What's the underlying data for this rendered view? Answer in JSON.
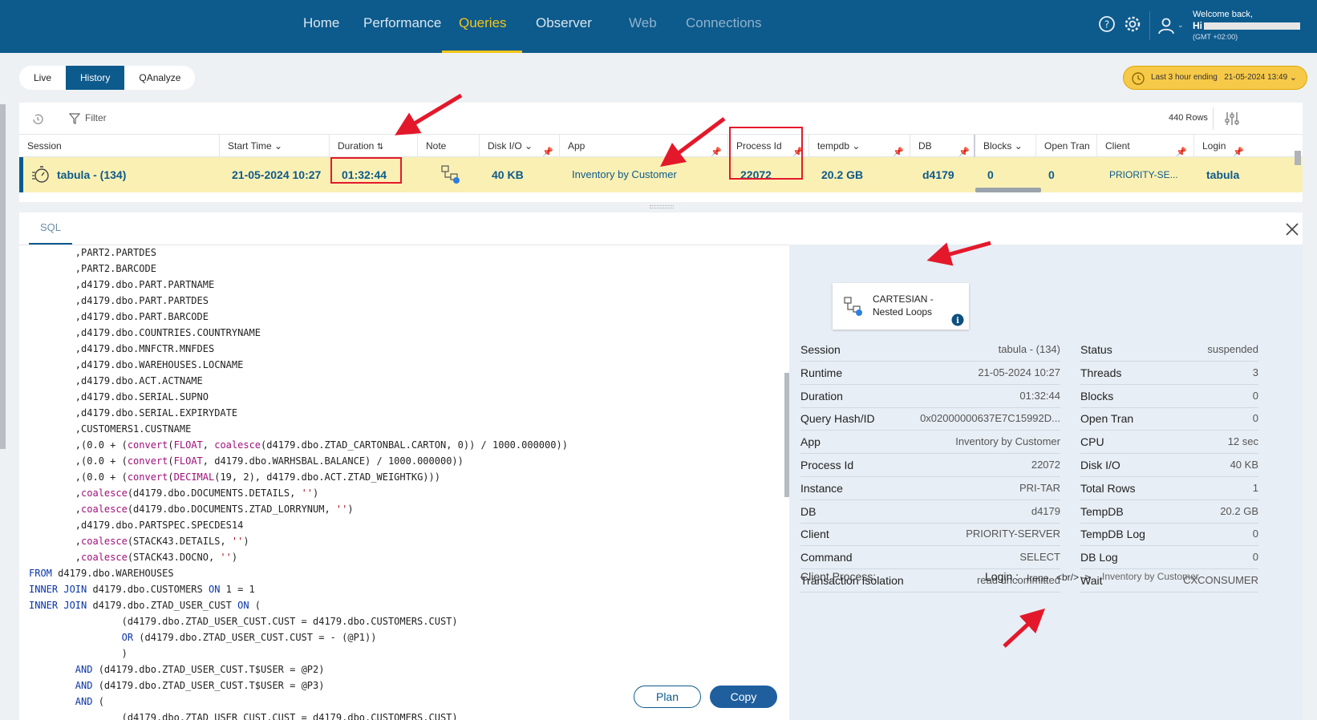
{
  "nav": {
    "items": [
      "Home",
      "Performance",
      "Queries",
      "Observer",
      "Web",
      "Connections"
    ],
    "welcome": "Welcome back,",
    "user_prefix": "Hi",
    "timezone": "(GMT +02:00)"
  },
  "view_tabs": [
    "Live",
    "History",
    "QAnalyze"
  ],
  "time_range": {
    "label": "Last 3 hour ending",
    "value": "21-05-2024 13:49"
  },
  "toolbar": {
    "filter": "Filter",
    "rows": "440 Rows"
  },
  "grid": {
    "headers": [
      "Session",
      "Start Time",
      "Duration",
      "Note",
      "Disk I/O",
      "App",
      "Process Id",
      "tempdb",
      "DB",
      "Blocks",
      "Open Tran",
      "Client",
      "Login"
    ],
    "row": {
      "session": "tabula - (134)",
      "start_time": "21-05-2024 10:27",
      "duration": "01:32:44",
      "disk_io": "40 KB",
      "app": "Inventory by Customer",
      "process_id": "22072",
      "tempdb": "20.2 GB",
      "db": "d4179",
      "blocks": "0",
      "open_tran": "0",
      "client": "PRIORITY-SE...",
      "login": "tabula"
    }
  },
  "sql": {
    "tab": "SQL",
    "plan_button": "Plan",
    "copy_button": "Copy",
    "lines": [
      "        ,PART2.PARTDES",
      "        ,PART2.BARCODE",
      "        ,d4179.dbo.PART.PARTNAME",
      "        ,d4179.dbo.PART.PARTDES",
      "        ,d4179.dbo.PART.BARCODE",
      "        ,d4179.dbo.COUNTRIES.COUNTRYNAME",
      "        ,d4179.dbo.MNFCTR.MNFDES",
      "        ,d4179.dbo.WAREHOUSES.LOCNAME",
      "        ,d4179.dbo.ACT.ACTNAME",
      "        ,d4179.dbo.SERIAL.SUPNO",
      "        ,d4179.dbo.SERIAL.EXPIRYDATE",
      "        ,CUSTOMERS1.CUSTNAME",
      "        ,(0.0 + (convert(FLOAT, coalesce(d4179.dbo.ZTAD_CARTONBAL.CARTON, 0)) / 1000.000000))",
      "        ,(0.0 + (convert(FLOAT, d4179.dbo.WARHSBAL.BALANCE) / 1000.000000))",
      "        ,(0.0 + (convert(DECIMAL(19, 2), d4179.dbo.ACT.ZTAD_WEIGHTKG)))",
      "        ,coalesce(d4179.dbo.DOCUMENTS.DETAILS, '')",
      "        ,coalesce(d4179.dbo.DOCUMENTS.ZTAD_LORRYNUM, '')",
      "        ,d4179.dbo.PARTSPEC.SPECDES14",
      "        ,coalesce(STACK43.DETAILS, '')",
      "        ,coalesce(STACK43.DOCNO, '')",
      "FROM d4179.dbo.WAREHOUSES",
      "INNER JOIN d4179.dbo.CUSTOMERS ON 1 = 1",
      "INNER JOIN d4179.dbo.ZTAD_USER_CUST ON (",
      "                (d4179.dbo.ZTAD_USER_CUST.CUST = d4179.dbo.CUSTOMERS.CUST)",
      "                OR (d4179.dbo.ZTAD_USER_CUST.CUST = - (@P1))",
      "                )",
      "        AND (d4179.dbo.ZTAD_USER_CUST.T$USER = @P2)",
      "        AND (d4179.dbo.ZTAD_USER_CUST.T$USER = @P3)",
      "        AND (",
      "                (d4179.dbo.ZTAD_USER_CUST.CUST = d4179.dbo.CUSTOMERS.CUST)"
    ]
  },
  "plan_card": {
    "line1": "CARTESIAN -",
    "line2": "Nested Loops"
  },
  "details_left": [
    {
      "k": "Session",
      "v": "tabula - (134)"
    },
    {
      "k": "Runtime",
      "v": "21-05-2024 10:27"
    },
    {
      "k": "Duration",
      "v": "01:32:44"
    },
    {
      "k": "Query Hash/ID",
      "v": "0x02000000637E7C15992D..."
    },
    {
      "k": "App",
      "v": "Inventory by Customer"
    },
    {
      "k": "Process Id",
      "v": "22072"
    },
    {
      "k": "Instance",
      "v": "PRI-TAR"
    },
    {
      "k": "DB",
      "v": "d4179"
    },
    {
      "k": "Client",
      "v": "PRIORITY-SERVER"
    },
    {
      "k": "Command",
      "v": "SELECT"
    },
    {
      "k": "Transaction Isolation",
      "v": "read uncommitted"
    }
  ],
  "details_right": [
    {
      "k": "Status",
      "v": "suspended"
    },
    {
      "k": "Threads",
      "v": "3"
    },
    {
      "k": "Blocks",
      "v": "0"
    },
    {
      "k": "Open Tran",
      "v": "0"
    },
    {
      "k": "CPU",
      "v": "12 sec"
    },
    {
      "k": "Disk I/O",
      "v": "40 KB"
    },
    {
      "k": "Total Rows",
      "v": "1"
    },
    {
      "k": "TempDB",
      "v": "20.2 GB"
    },
    {
      "k": "TempDB Log",
      "v": "0"
    },
    {
      "k": "DB Log",
      "v": "0"
    },
    {
      "k": "Wait",
      "v": "CXCONSUMER"
    }
  ],
  "client_process": {
    "label": "Client Process:",
    "login_label": "Login :",
    "login_value": "Irene",
    "separator": "<br/> ->",
    "app": "Inventory by Customer"
  },
  "colors": {
    "nav": "#0d5a8c",
    "accent": "#f5c518",
    "row_highlight": "#fbf0b4",
    "annotation": "#e3192b"
  }
}
